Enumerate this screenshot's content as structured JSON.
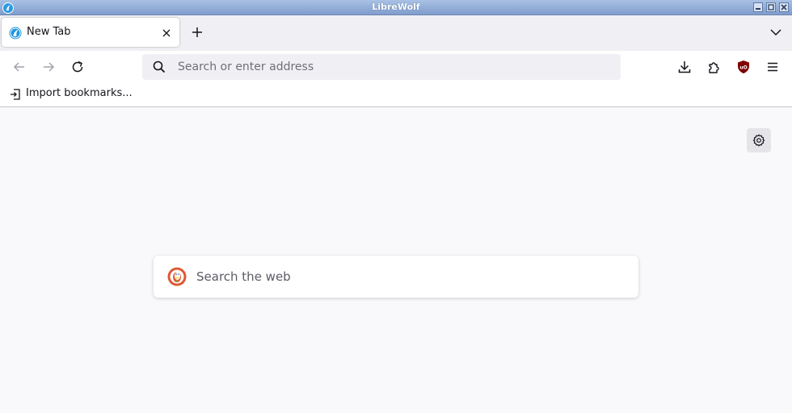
{
  "window": {
    "title": "LibreWolf",
    "controls": [
      "minimize",
      "maximize",
      "close"
    ]
  },
  "tabs": [
    {
      "label": "New Tab",
      "active": true,
      "icon": "librewolf-icon"
    }
  ],
  "navbar": {
    "url_placeholder": "Search or enter address",
    "url_value": ""
  },
  "bookmarks_toolbar": {
    "import_label": "Import bookmarks..."
  },
  "newtab": {
    "search_placeholder": "Search the web",
    "search_engine_icon": "duckduckgo-logo"
  },
  "colors": {
    "accent": "#0a84ff",
    "ublock": "#800000"
  }
}
